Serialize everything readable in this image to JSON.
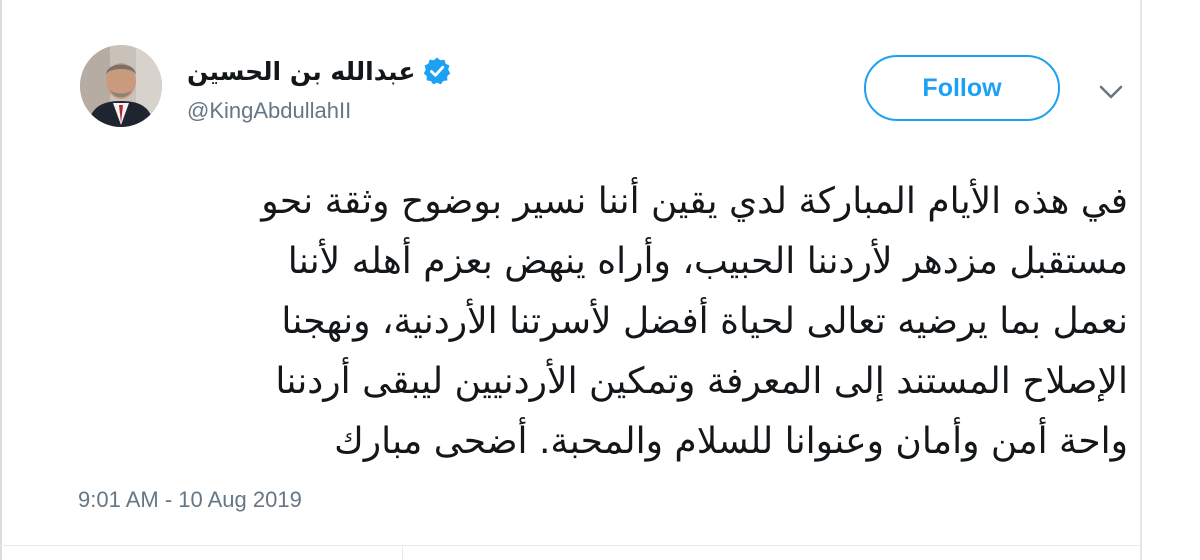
{
  "author": {
    "display_name": "عبدالله بن الحسين",
    "handle": "@KingAbdullahII",
    "verified": true,
    "avatar": "profile-photo"
  },
  "follow_button": {
    "label": "Follow"
  },
  "menu_icon": "chevron-down-icon",
  "tweet": {
    "lines": [
      "في هذه الأيام المباركة لدي يقين أننا نسير بوضوح وثقة نحو",
      "مستقبل مزدهر لأردننا الحبيب، وأراه ينهض بعزم أهله لأننا",
      "نعمل بما يرضيه تعالى لحياة أفضل لأسرتنا الأردنية، ونهجنا",
      "الإصلاح المستند إلى المعرفة وتمكين الأردنيين ليبقى أردننا",
      "واحة أمن وأمان وعنوانا للسلام والمحبة. أضحى مبارك"
    ]
  },
  "timestamp": "9:01 AM - 10 Aug 2019",
  "colors": {
    "accent": "#1da1f2",
    "text": "#14171a",
    "secondary_text": "#657786"
  }
}
